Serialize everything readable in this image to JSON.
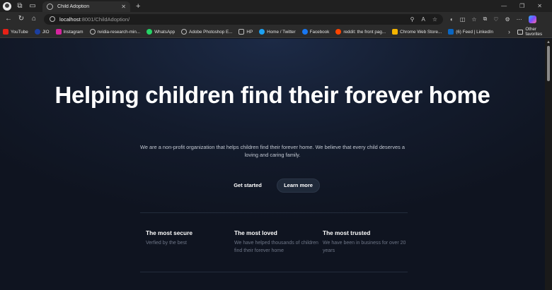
{
  "browser": {
    "tab_title": "Child Adoption",
    "tab_close": "✕",
    "new_tab": "+",
    "url_host": "localhost",
    "url_path": ":8001/ChildAdoption/",
    "window_controls": {
      "minimize": "—",
      "maximize": "❐",
      "close": "✕"
    }
  },
  "favorites": [
    {
      "label": "YouTube",
      "color": "#e62117"
    },
    {
      "label": "JIO",
      "color": "#1b3fa0"
    },
    {
      "label": "Instagram",
      "color": "#d6249f"
    },
    {
      "label": "nvidia-research-min...",
      "color": "#9e9e9e"
    },
    {
      "label": "WhatsApp",
      "color": "#25d366"
    },
    {
      "label": "Adobe Photoshop E...",
      "color": "#9e9e9e"
    },
    {
      "label": "HP",
      "color": "#9e9e9e"
    },
    {
      "label": "Home / Twitter",
      "color": "#1da1f2"
    },
    {
      "label": "Facebook",
      "color": "#1877f2"
    },
    {
      "label": "reddit: the front pag...",
      "color": "#ff4500"
    },
    {
      "label": "Chrome Web Store...",
      "color": "#f4b400"
    },
    {
      "label": "(6) Feed | LinkedIn",
      "color": "#0a66c2"
    }
  ],
  "favorites_more": "›",
  "other_favorites": "Other favorites",
  "hero": {
    "title": "Helping children find their forever home",
    "subtitle": "We are a non-profit organization that helps children find their forever home. We believe that every child deserves a loving and caring family."
  },
  "actions": {
    "get_started": "Get started",
    "learn_more": "Learn more"
  },
  "features": [
    {
      "title": "The most secure",
      "desc": "Verfied by the best"
    },
    {
      "title": "The most loved",
      "desc": "We have helped thousands of children find their forever home"
    },
    {
      "title": "The most trusted",
      "desc": "We have been in business for over 20 years"
    }
  ]
}
